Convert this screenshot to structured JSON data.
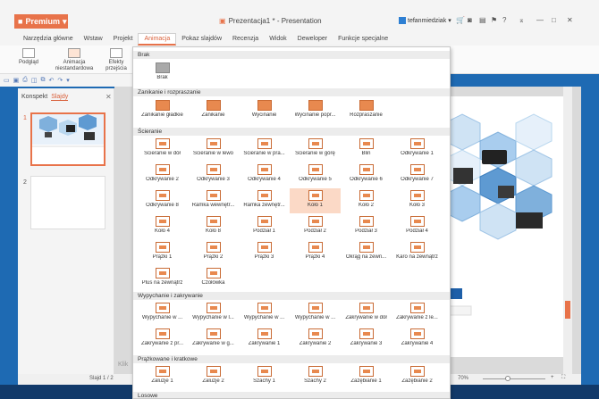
{
  "app": {
    "premium_label": "Premium",
    "doc_title": "Prezentacja1 * - Presentation",
    "user": "tefanmiedziak"
  },
  "tabs": [
    "Narzędzia główne",
    "Wstaw",
    "Projekt",
    "Animacja",
    "Pokaz slajdów",
    "Recenzja",
    "Widok",
    "Deweloper",
    "Funkcje specjalne"
  ],
  "ribbon": {
    "preview": "Podgląd",
    "custom_anim_1": "Animacja",
    "custom_anim_2": "niestandardowa",
    "effects_1": "Efekty",
    "effects_2": "przejścia"
  },
  "panel": {
    "tab_outline": "Konspekt",
    "tab_slides": "Slajdy",
    "slide1": "1",
    "slide2": "2"
  },
  "status": {
    "slide": "Slajd 1 / 2",
    "zoom": "70%",
    "notes_hint": "Klik"
  },
  "dropdown": {
    "sections": [
      "Brak",
      "Zanikanie i rozpraszanie",
      "Ścieranie",
      "Wypychanie i zakrywanie",
      "Prążkowane i kratkowe",
      "Losowe"
    ],
    "brak": [
      "Brak"
    ],
    "zanikanie": [
      "Zanikanie gładkie",
      "Zanikanie",
      "Wycinanie",
      "Wycinanie popr...",
      "Rozpraszanie"
    ],
    "scieranie": [
      "Ścieranie w dół",
      "Ścieranie w lewo",
      "Ścieranie w pra...",
      "Ścieranie w górę",
      "Blin",
      "Odkrywanie 1",
      "Odkrywanie 2",
      "Odkrywanie 3",
      "Odkrywanie 4",
      "Odkrywanie 5",
      "Odkrywanie 6",
      "Odkrywanie 7",
      "Odkrywanie 8",
      "Ramka wewnętr...",
      "Ramka zewnętr...",
      "Koło 1",
      "Koło 2",
      "Koło 3",
      "Koło 4",
      "Koło 8",
      "Podział 1",
      "Podział 2",
      "Podział 3",
      "Podział 4",
      "Prążki 1",
      "Prążki 2",
      "Prążki 3",
      "Prążki 4",
      "Okrąg na zewn...",
      "Karo na zewnątrz",
      "Plus na zewnątrz",
      "Czołówka"
    ],
    "wypychanie": [
      "Wypychanie w ...",
      "Wypychanie w l...",
      "Wypychanie w ...",
      "Wypychanie w ...",
      "Zakrywanie w dół",
      "Zakrywanie z le...",
      "Zakrywanie z pr...",
      "Zakrywanie w g...",
      "Zakrywanie 1",
      "Zakrywanie 2",
      "Zakrywanie 3",
      "Zakrywanie 4"
    ],
    "prazkowane": [
      "Żaluzje 1",
      "Żaluzje 2",
      "Szachy 1",
      "Szachy 2",
      "Zazębianie 1",
      "Zazębianie 2"
    ],
    "selected": "Koło 1"
  },
  "colors": {
    "accent": "#e8734a",
    "selected_bg": "#fbd9c6"
  }
}
